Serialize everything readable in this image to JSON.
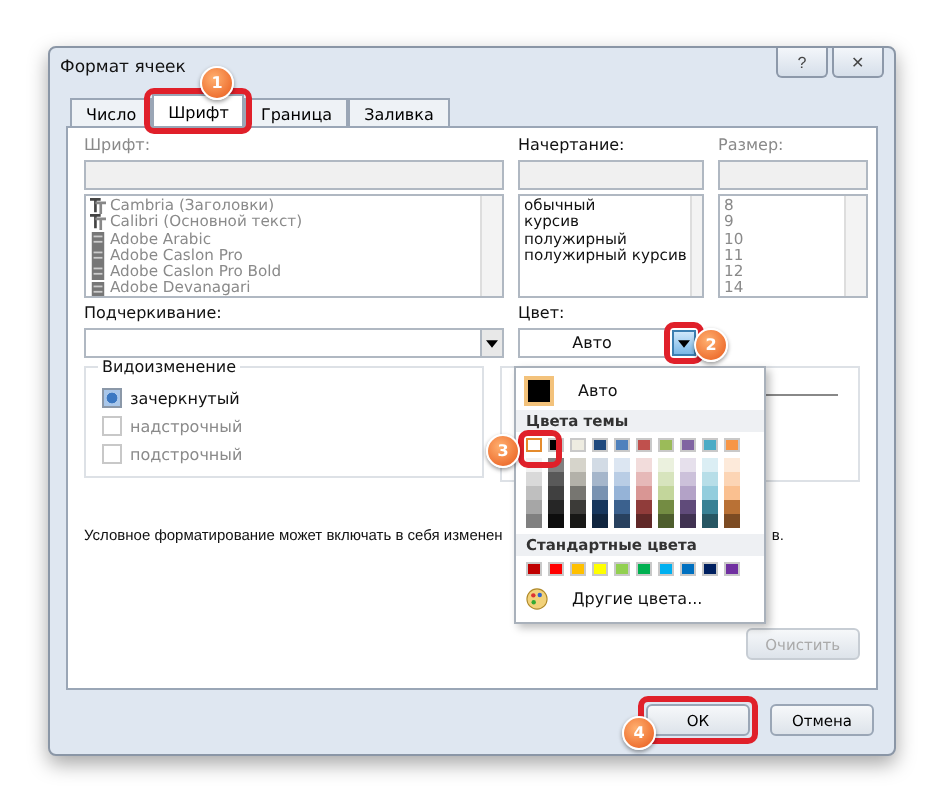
{
  "window": {
    "title": "Формат ячеек",
    "help_button": "?",
    "close_button": "✕"
  },
  "tabs": [
    {
      "label": "Число",
      "selected": false,
      "highlighted": false
    },
    {
      "label": "Шрифт",
      "selected": true,
      "highlighted": true,
      "callout": "1"
    },
    {
      "label": "Граница",
      "selected": false,
      "highlighted": false
    },
    {
      "label": "Заливка",
      "selected": false,
      "highlighted": false
    }
  ],
  "font": {
    "label": "Шрифт:",
    "items": [
      {
        "name": "Cambria (Заголовки)",
        "kind": "truetype"
      },
      {
        "name": "Calibri (Основной текст)",
        "kind": "truetype"
      },
      {
        "name": "Adobe Arabic",
        "kind": "opentype"
      },
      {
        "name": "Adobe Caslon Pro",
        "kind": "opentype"
      },
      {
        "name": "Adobe Caslon Pro Bold",
        "kind": "opentype"
      },
      {
        "name": "Adobe Devanagari",
        "kind": "opentype"
      }
    ]
  },
  "style": {
    "label": "Начертание:",
    "items": [
      "обычный",
      "курсив",
      "полужирный",
      "полужирный курсив"
    ]
  },
  "size": {
    "label": "Размер:",
    "items": [
      "8",
      "9",
      "10",
      "11",
      "12",
      "14"
    ]
  },
  "underline": {
    "label": "Подчеркивание:"
  },
  "color": {
    "label": "Цвет:",
    "value": "Авто",
    "callout": "2",
    "highlighted": true
  },
  "effects": {
    "title": "Видоизменение",
    "items": [
      {
        "label": "зачеркнутый",
        "checked": true,
        "disabled": false
      },
      {
        "label": "надстрочный",
        "checked": false,
        "disabled": true
      },
      {
        "label": "подстрочный",
        "checked": false,
        "disabled": true
      }
    ]
  },
  "note": {
    "before": "Условное форматирование может включать в себя изменен",
    "after": "в."
  },
  "color_menu": {
    "auto_label": "Авто",
    "theme_title": "Цвета темы",
    "callout": "3",
    "theme_colors": [
      {
        "color": "#ffffff",
        "selected": true
      },
      {
        "color": "#000000",
        "selected": false
      },
      {
        "color": "#eeece1",
        "selected": false
      },
      {
        "color": "#1f497d",
        "selected": false
      },
      {
        "color": "#4f81bd",
        "selected": false
      },
      {
        "color": "#c0504d",
        "selected": false
      },
      {
        "color": "#9bbb59",
        "selected": false
      },
      {
        "color": "#8064a2",
        "selected": false
      },
      {
        "color": "#4bacc6",
        "selected": false
      },
      {
        "color": "#f79646",
        "selected": false
      }
    ],
    "standard_title": "Стандартные цвета",
    "standard_colors": [
      {
        "color": "#c00000"
      },
      {
        "color": "#ff0000"
      },
      {
        "color": "#ffc000"
      },
      {
        "color": "#ffff00"
      },
      {
        "color": "#92d050"
      },
      {
        "color": "#00b050"
      },
      {
        "color": "#00b0f0"
      },
      {
        "color": "#0070c0"
      },
      {
        "color": "#002060"
      },
      {
        "color": "#7030a0"
      }
    ],
    "more_label": "Другие цвета..."
  },
  "clear_button": {
    "label": "Очистить",
    "disabled": true
  },
  "buttons": [
    {
      "label": "ОК",
      "highlighted": true,
      "callout": "4"
    },
    {
      "label": "Отмена",
      "highlighted": false
    }
  ]
}
